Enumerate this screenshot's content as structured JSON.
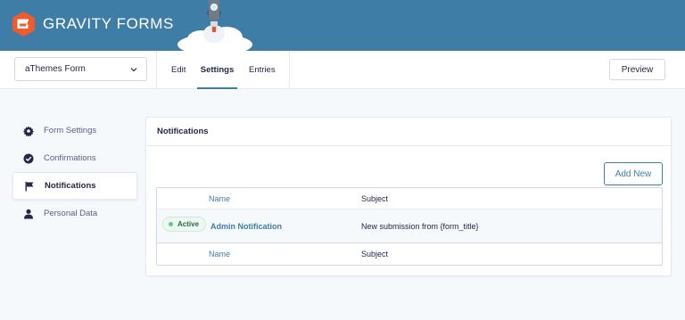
{
  "header": {
    "brand": "GRAVITY FORMS",
    "brand_color": "#3e7da6",
    "logo_color": "#f15a2b"
  },
  "toolbar": {
    "form_selector_value": "aThemes Form",
    "tabs": [
      {
        "label": "Edit",
        "active": false
      },
      {
        "label": "Settings",
        "active": true
      },
      {
        "label": "Entries",
        "active": false
      }
    ],
    "preview_label": "Preview"
  },
  "sidebar": {
    "items": [
      {
        "label": "Form Settings",
        "icon": "gear-icon",
        "active": false
      },
      {
        "label": "Confirmations",
        "icon": "check-circle-icon",
        "active": false
      },
      {
        "label": "Notifications",
        "icon": "flag-icon",
        "active": true
      },
      {
        "label": "Personal Data",
        "icon": "user-icon",
        "active": false
      }
    ]
  },
  "panel": {
    "title": "Notifications",
    "add_label": "Add New",
    "table": {
      "headers": {
        "name": "Name",
        "subject": "Subject"
      },
      "rows": [
        {
          "status": "Active",
          "name": "Admin Notification",
          "subject": "New submission from {form_title}"
        }
      ],
      "footers": {
        "name": "Name",
        "subject": "Subject"
      }
    }
  }
}
